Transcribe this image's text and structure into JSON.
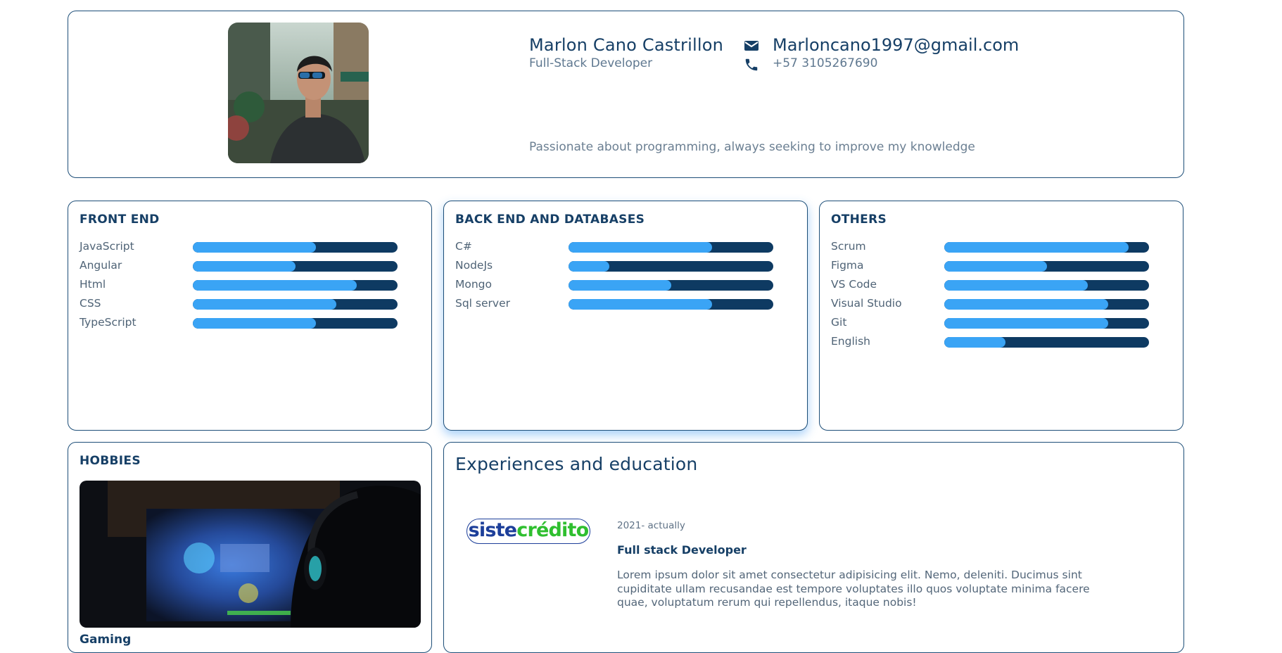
{
  "profile": {
    "name": "Marlon Cano Castrillon",
    "role": "Full-Stack Developer",
    "email": "Marloncano1997@gmail.com",
    "phone": "+57 3105267690",
    "bio": "Passionate about programming, always seeking to improve my knowledge"
  },
  "skill_groups": [
    {
      "title": "FRONT END",
      "skills": [
        {
          "name": "JavaScript",
          "level": 0.6
        },
        {
          "name": "Angular",
          "level": 0.5
        },
        {
          "name": "Html",
          "level": 0.8
        },
        {
          "name": "CSS",
          "level": 0.7
        },
        {
          "name": "TypeScript",
          "level": 0.6
        }
      ]
    },
    {
      "title": "BACK END AND DATABASES",
      "skills": [
        {
          "name": "C#",
          "level": 0.7
        },
        {
          "name": "NodeJs",
          "level": 0.2
        },
        {
          "name": "Mongo",
          "level": 0.5
        },
        {
          "name": "Sql server",
          "level": 0.7
        }
      ]
    },
    {
      "title": "OTHERS",
      "skills": [
        {
          "name": "Scrum",
          "level": 0.9
        },
        {
          "name": "Figma",
          "level": 0.5
        },
        {
          "name": "VS Code",
          "level": 0.7
        },
        {
          "name": "Visual Studio",
          "level": 0.8
        },
        {
          "name": "Git",
          "level": 0.8
        },
        {
          "name": "English",
          "level": 0.3
        }
      ]
    }
  ],
  "hobbies": {
    "title": "HOBBIES",
    "caption": "Gaming"
  },
  "experience": {
    "title": "Experiences and education",
    "company_logo": {
      "part1": "siste",
      "part2": "crédito"
    },
    "date": "2021- actually",
    "role": "Full stack Developer",
    "description": "Lorem ipsum dolor sit amet consectetur adipisicing elit. Nemo, deleniti. Ducimus sint cupiditate ullam recusandae est tempore voluptates illo quos voluptate minima facere quae, voluptatum rerum qui repellendus, itaque nobis!"
  },
  "colors": {
    "primary": "#163f66",
    "bar_track": "#0e3a62",
    "bar_fill": "#3aa4f5",
    "logo_blue": "#1d3f9a",
    "logo_green": "#2fbf2f"
  },
  "icons": {
    "email": "mail-icon",
    "phone": "phone-icon"
  }
}
